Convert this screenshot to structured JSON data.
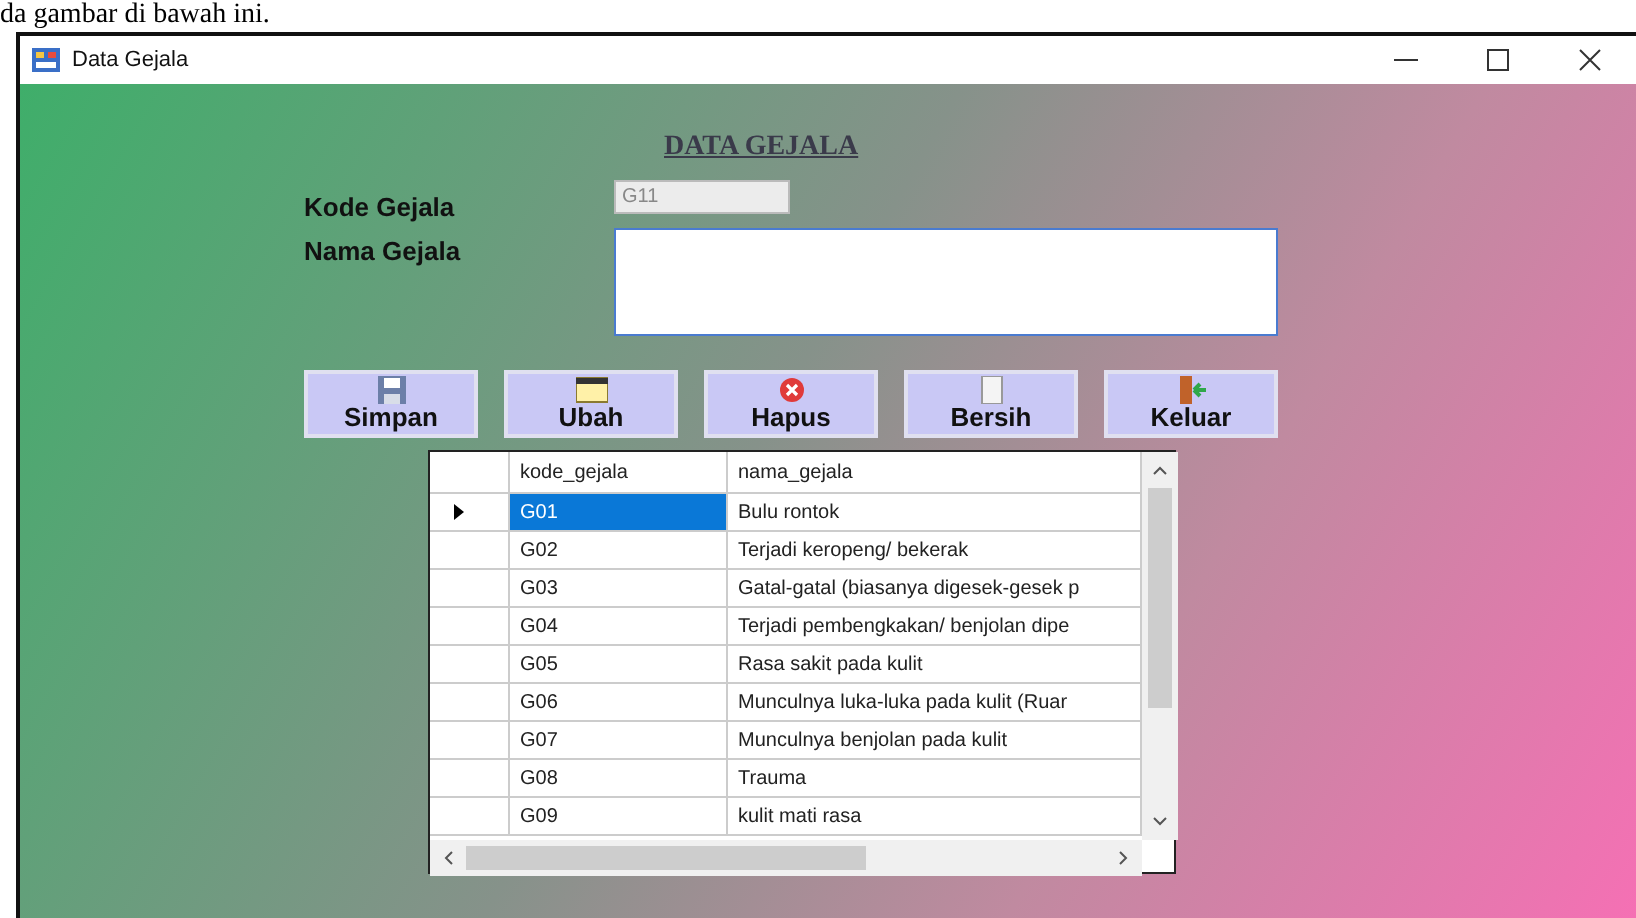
{
  "document_text": "da gambar di bawah ini.",
  "window": {
    "title": "Data Gejala"
  },
  "form": {
    "heading": "DATA GEJALA",
    "fields": [
      {
        "label": "Kode Gejala",
        "kind": "line",
        "value": "G11",
        "disabled": true
      },
      {
        "label": "Nama Gejala",
        "kind": "area",
        "disabled": false
      }
    ]
  },
  "buttons": [
    {
      "label": "Simpan",
      "kind": "save"
    },
    {
      "label": "Ubah",
      "kind": "edit"
    },
    {
      "label": "Hapus",
      "kind": "delete"
    },
    {
      "label": "Bersih",
      "kind": "clear"
    },
    {
      "label": "Keluar",
      "kind": "exit"
    }
  ],
  "table": {
    "columns": [
      "kode_gejala",
      "nama_gejala"
    ],
    "rows": [
      {
        "cells": [
          "G01",
          "Bulu rontok"
        ],
        "selected": true
      },
      {
        "cells": [
          "G02",
          "Terjadi keropeng/ bekerak"
        ],
        "selected": false
      },
      {
        "cells": [
          "G03",
          "Gatal-gatal (biasanya digesek-gesek p"
        ],
        "selected": false
      },
      {
        "cells": [
          "G04",
          "Terjadi pembengkakan/ benjolan dipe"
        ],
        "selected": false
      },
      {
        "cells": [
          "G05",
          "Rasa sakit pada kulit"
        ],
        "selected": false
      },
      {
        "cells": [
          "G06",
          "Munculnya luka-luka pada kulit (Ruar"
        ],
        "selected": false
      },
      {
        "cells": [
          "G07",
          "Munculnya benjolan pada kulit"
        ],
        "selected": false
      },
      {
        "cells": [
          "G08",
          "Trauma"
        ],
        "selected": false
      },
      {
        "cells": [
          "G09",
          "kulit mati rasa"
        ],
        "selected": false
      }
    ]
  }
}
